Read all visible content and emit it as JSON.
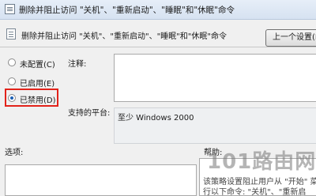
{
  "window": {
    "title": "删除并阻止访问 \"关机\"、\"重新启动\"、\"睡眠\"和\"休眠\"命令"
  },
  "header": {
    "setting_name": "删除并阻止访问 \"关机\"、\"重新启动\"、\"睡眠\"和\"休眠\"命令",
    "prev_button": "上一个设置(P)"
  },
  "radios": [
    {
      "label": "未配置(C)",
      "selected": false
    },
    {
      "label": "已启用(E)",
      "selected": false
    },
    {
      "label": "已禁用(D)",
      "selected": true
    }
  ],
  "labels": {
    "note": "注释:",
    "platform": "支持的平台:",
    "options": "选项:",
    "help": "帮助:"
  },
  "platform_value": "至少 Windows 2000",
  "help_text": [
    "该策略设置阻止用户从 \"开始\" 菜",
    "行以下命令: \"关机\"、\"重新启"
  ],
  "watermark": "101路由网",
  "colors": {
    "highlight": "#e2231a",
    "radio_selected": "#1b5fb3"
  }
}
